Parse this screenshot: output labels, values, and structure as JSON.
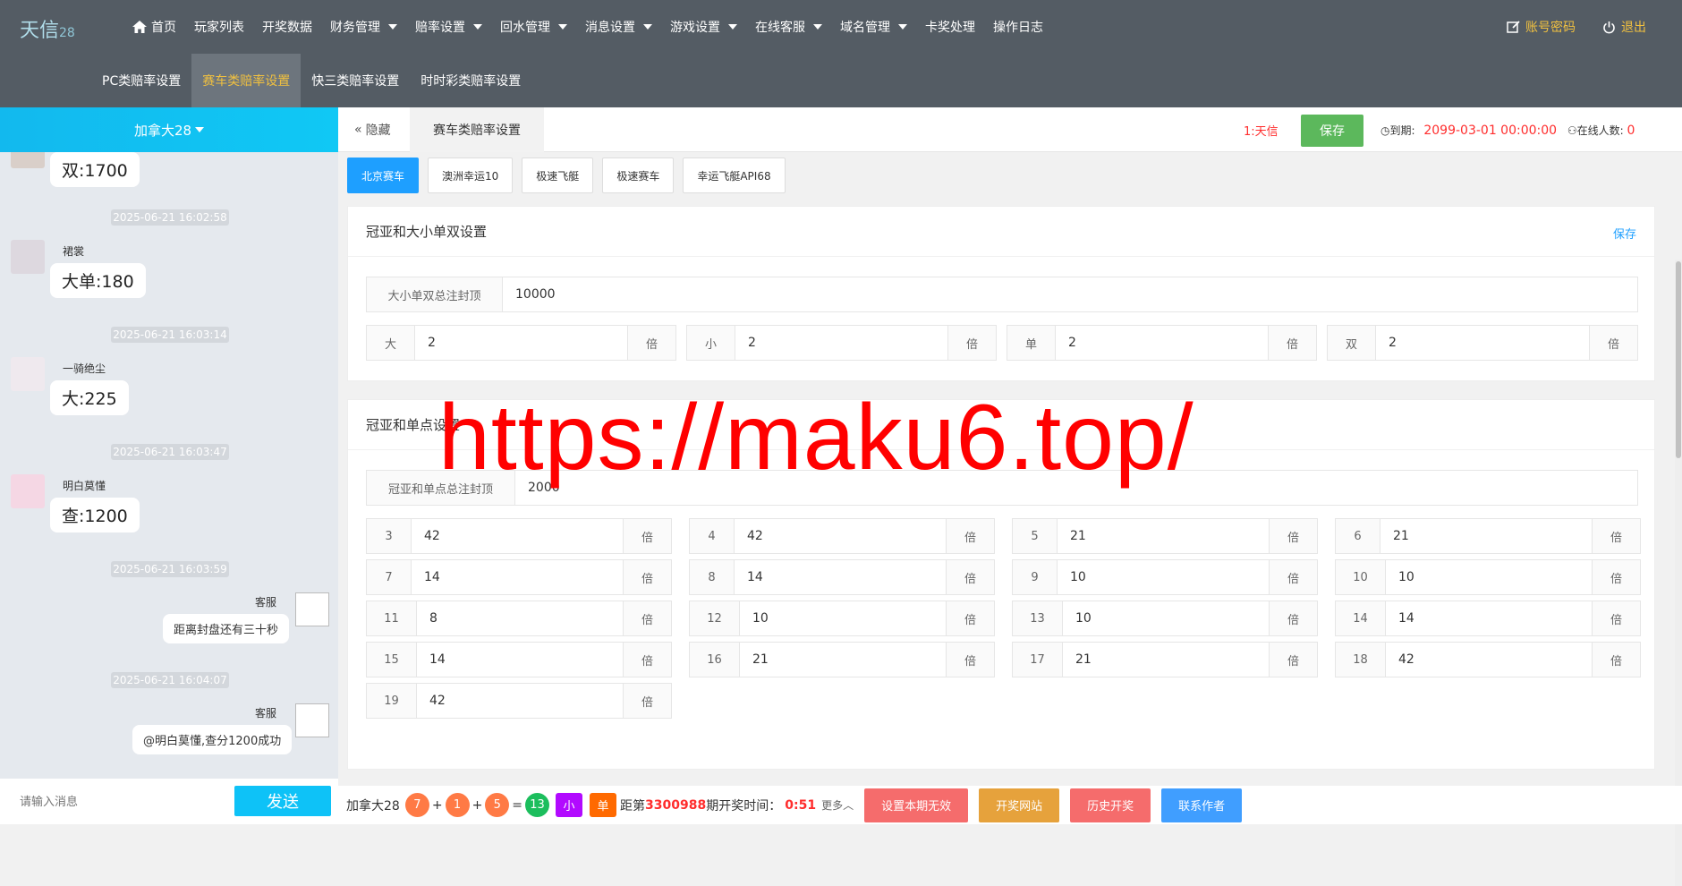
{
  "app": {
    "logo": "天信",
    "logo_suffix": "28"
  },
  "nav": [
    {
      "label": "首页",
      "icon": "home-icon",
      "dropdown": false
    },
    {
      "label": "玩家列表",
      "dropdown": false
    },
    {
      "label": "开奖数据",
      "dropdown": false
    },
    {
      "label": "财务管理",
      "dropdown": true
    },
    {
      "label": "赔率设置",
      "dropdown": true
    },
    {
      "label": "回水管理",
      "dropdown": true
    },
    {
      "label": "消息设置",
      "dropdown": true
    },
    {
      "label": "游戏设置",
      "dropdown": true
    },
    {
      "label": "在线客服",
      "dropdown": true
    },
    {
      "label": "域名管理",
      "dropdown": true
    },
    {
      "label": "卡奖处理",
      "dropdown": false
    },
    {
      "label": "操作日志",
      "dropdown": false
    }
  ],
  "top_right": {
    "account": "账号密码",
    "logout": "退出",
    "icons": [
      "edit-icon",
      "power-icon"
    ]
  },
  "subnav": [
    {
      "label": "PC类赔率设置",
      "active": false
    },
    {
      "label": "赛车类赔率设置",
      "active": true
    },
    {
      "label": "快三类赔率设置",
      "active": false
    },
    {
      "label": "时时彩类赔率设置",
      "active": false
    }
  ],
  "chat": {
    "room": "加拿大28",
    "messages": [
      {
        "type": "bubble",
        "text": "双:1700"
      },
      {
        "type": "time",
        "text": "2025-06-21 16:02:58"
      },
      {
        "type": "user",
        "name": "裙裳",
        "text": "大单:180"
      },
      {
        "type": "time",
        "text": "2025-06-21 16:03:14"
      },
      {
        "type": "user",
        "name": "一骑绝尘",
        "text": "大:225"
      },
      {
        "type": "time",
        "text": "2025-06-21 16:03:47"
      },
      {
        "type": "user",
        "name": "明白莫懂",
        "text": "查:1200"
      },
      {
        "type": "time",
        "text": "2025-06-21 16:03:59"
      },
      {
        "type": "service",
        "name": "客服",
        "text": "距离封盘还有三十秒"
      },
      {
        "type": "time",
        "text": "2025-06-21 16:04:07"
      },
      {
        "type": "service",
        "name": "客服",
        "text": "@明白莫懂,查分1200成功"
      }
    ],
    "input_placeholder": "请输入消息",
    "send_label": "发送"
  },
  "main": {
    "hide_label": "隐藏",
    "tab_label": "赛车类赔率设置",
    "current_user": "1:天信",
    "save_label": "保存",
    "expire_label": "到期:",
    "expire_value": "2099-03-01 00:00:00",
    "online_label": "在线人数:",
    "online_value": "0",
    "game_tabs": [
      {
        "label": "北京赛车",
        "active": true
      },
      {
        "label": "澳洲幸运10",
        "active": false
      },
      {
        "label": "极速飞艇",
        "active": false
      },
      {
        "label": "极速赛车",
        "active": false
      },
      {
        "label": "幸运飞艇API68",
        "active": false
      }
    ]
  },
  "card1": {
    "title": "冠亚和大小单双设置",
    "save_label": "保存",
    "cap_label": "大小单双总注封顶",
    "cap_value": "10000",
    "fields": [
      {
        "label": "大",
        "value": "2",
        "unit": "倍"
      },
      {
        "label": "小",
        "value": "2",
        "unit": "倍"
      },
      {
        "label": "单",
        "value": "2",
        "unit": "倍"
      },
      {
        "label": "双",
        "value": "2",
        "unit": "倍"
      }
    ]
  },
  "card2": {
    "title": "冠亚和单点设置",
    "cap_label": "冠亚和单点总注封顶",
    "cap_value": "2000",
    "fields": [
      {
        "label": "3",
        "value": "42",
        "unit": "倍"
      },
      {
        "label": "4",
        "value": "42",
        "unit": "倍"
      },
      {
        "label": "5",
        "value": "21",
        "unit": "倍"
      },
      {
        "label": "6",
        "value": "21",
        "unit": "倍"
      },
      {
        "label": "7",
        "value": "14",
        "unit": "倍"
      },
      {
        "label": "8",
        "value": "14",
        "unit": "倍"
      },
      {
        "label": "9",
        "value": "10",
        "unit": "倍"
      },
      {
        "label": "10",
        "value": "10",
        "unit": "倍"
      },
      {
        "label": "11",
        "value": "8",
        "unit": "倍"
      },
      {
        "label": "12",
        "value": "10",
        "unit": "倍"
      },
      {
        "label": "13",
        "value": "10",
        "unit": "倍"
      },
      {
        "label": "14",
        "value": "14",
        "unit": "倍"
      },
      {
        "label": "15",
        "value": "14",
        "unit": "倍"
      },
      {
        "label": "16",
        "value": "21",
        "unit": "倍"
      },
      {
        "label": "17",
        "value": "21",
        "unit": "倍"
      },
      {
        "label": "18",
        "value": "42",
        "unit": "倍"
      },
      {
        "label": "19",
        "value": "42",
        "unit": "倍"
      }
    ]
  },
  "watermark": "https://maku6.top/",
  "footer": {
    "game": "加拿大28",
    "balls": [
      "7",
      "1",
      "5"
    ],
    "plus": "+",
    "equals": "=",
    "sum": "13",
    "size_tag": "小",
    "parity_tag": "单",
    "period_prefix": "距第",
    "period": "3300988",
    "period_suffix": "期开奖时间：",
    "countdown": "0:51",
    "more": "更多",
    "buttons": [
      {
        "label": "设置本期无效",
        "color": "#f56c6c"
      },
      {
        "label": "开奖网站",
        "color": "#e6a23c"
      },
      {
        "label": "历史开奖",
        "color": "#f56c6c"
      },
      {
        "label": "联系作者",
        "color": "#409eff"
      }
    ]
  },
  "colors": {
    "topbar": "#545c64",
    "accent": "#f0c040",
    "primary": "#1e9fff",
    "chat_header": "#10c8f5",
    "save": "#5cb85c",
    "watermark": "#ff0000"
  }
}
